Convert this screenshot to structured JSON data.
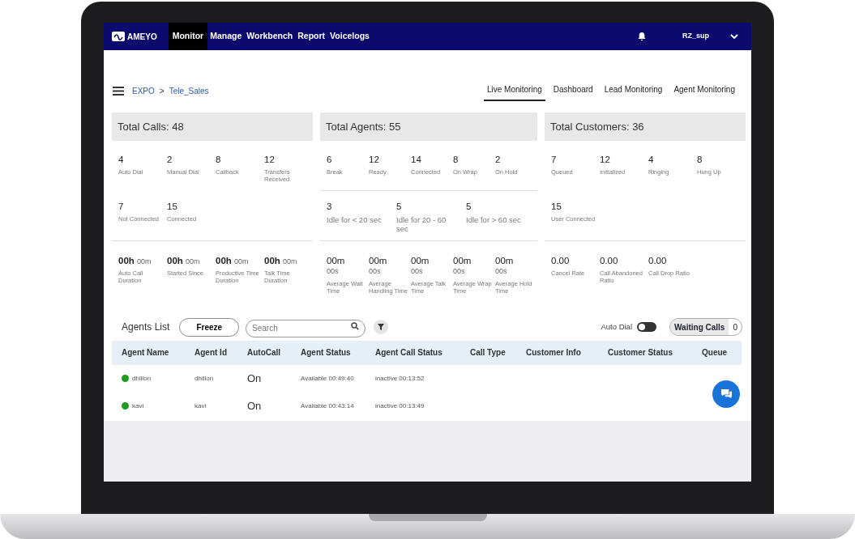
{
  "navbar": {
    "logo": "AMEYO",
    "menu": [
      {
        "label": "Monitor",
        "selected": true
      },
      {
        "label": "Manage",
        "selected": false
      },
      {
        "label": "Workbench",
        "selected": false
      },
      {
        "label": "Report",
        "selected": false
      },
      {
        "label": "Voicelogs",
        "selected": false
      }
    ],
    "user": "RZ_sup"
  },
  "breadcrumb": [
    "EXPO",
    "Tele_Sales"
  ],
  "breadcrumb_separator": ">",
  "tabs": [
    {
      "label": "Live Monitoring",
      "selected": true
    },
    {
      "label": "Dashboard",
      "selected": false
    },
    {
      "label": "Lead Monitoring",
      "selected": false
    },
    {
      "label": "Agent Monitoring",
      "selected": false
    }
  ],
  "panels": [
    {
      "title": "Total Calls: 48",
      "groups": [
        {
          "items": [
            {
              "kind": "count",
              "value": "4",
              "label": "Auto Dial"
            },
            {
              "kind": "count",
              "value": "2",
              "label": "Manual Dial"
            },
            {
              "kind": "count",
              "value": "8",
              "label": "Callback"
            },
            {
              "kind": "count",
              "value": "12",
              "label": "Transfers Received"
            }
          ]
        },
        {
          "items": [
            {
              "kind": "count",
              "value": "7",
              "label": "Not Connected"
            },
            {
              "kind": "count",
              "value": "15",
              "label": "Connected"
            }
          ]
        },
        {
          "items": [
            {
              "kind": "inline",
              "value": "00h",
              "sub": "00m",
              "label": "Auto Call Duration"
            },
            {
              "kind": "inline",
              "value": "00h",
              "sub": "00m",
              "label": "Started Since"
            },
            {
              "kind": "inline",
              "value": "00h",
              "sub": "00m",
              "label": "Productive Time Duration"
            },
            {
              "kind": "inline",
              "value": "00h",
              "sub": "00m",
              "label": "Talk Time Duration"
            }
          ]
        }
      ]
    },
    {
      "title": "Total Agents: 55",
      "groups": [
        {
          "items": [
            {
              "kind": "count",
              "value": "6",
              "label": "Break"
            },
            {
              "kind": "count",
              "value": "12",
              "label": "Ready"
            },
            {
              "kind": "count",
              "value": "14",
              "label": "Connected"
            },
            {
              "kind": "count",
              "value": "8",
              "label": "On Wrap"
            },
            {
              "kind": "count",
              "value": "2",
              "label": "On Hold"
            }
          ]
        },
        {
          "items": [
            {
              "kind": "idle",
              "value": "3",
              "label": "Idle for < 20 sec"
            },
            {
              "kind": "idle",
              "value": "5",
              "label": "Idle for 20 - 60 sec"
            },
            {
              "kind": "idle",
              "value": "5",
              "label": "Idle for > 60 sec"
            }
          ]
        },
        {
          "items": [
            {
              "kind": "stacked",
              "value": "00m",
              "sub": "00s",
              "label": "Average Wait Time"
            },
            {
              "kind": "stacked",
              "value": "00m",
              "sub": "00s",
              "label": "Average Handling Time"
            },
            {
              "kind": "stacked",
              "value": "00m",
              "sub": "00s",
              "label": "Average Talk Time"
            },
            {
              "kind": "stacked",
              "value": "00m",
              "sub": "00s",
              "label": "Average Wrap Time"
            },
            {
              "kind": "stacked",
              "value": "00m",
              "sub": "00s",
              "label": "Average Hold Time"
            }
          ]
        }
      ]
    },
    {
      "title": "Total Customers: 36",
      "groups": [
        {
          "items": [
            {
              "kind": "count",
              "value": "7",
              "label": "Queued"
            },
            {
              "kind": "count",
              "value": "12",
              "label": "Initialized"
            },
            {
              "kind": "count",
              "value": "4",
              "label": "Ringing"
            },
            {
              "kind": "count",
              "value": "8",
              "label": "Hung Up"
            }
          ]
        },
        {
          "items": [
            {
              "kind": "count",
              "value": "15",
              "label": "User Connected"
            }
          ]
        },
        {
          "items": [
            {
              "kind": "rate",
              "value": "0.00",
              "label": "Cancel Rate"
            },
            {
              "kind": "rate",
              "value": "0.00",
              "label": "Call Abandoned Ratio"
            },
            {
              "kind": "rate",
              "value": "0.00",
              "label": "Call Drop Ratio"
            }
          ]
        }
      ]
    }
  ],
  "agents_list": {
    "title": "Agents List",
    "freeze_button": "Freeze",
    "search": {
      "placeholder": "Search"
    },
    "auto_dial": {
      "label": "Auto Dial",
      "on": false
    },
    "waiting_calls": {
      "label": "Waiting Calls",
      "count": "0"
    }
  },
  "table": {
    "columns": [
      "Agent Name",
      "Agent Id",
      "AutoCall",
      "Agent Status",
      "Agent Call Status",
      "Call Type",
      "Customer Info",
      "Customer Status",
      "Queue"
    ],
    "rows": [
      {
        "color": "#1e9a1e",
        "name": "dhillon",
        "id": "dhillon",
        "autocall": "On",
        "status": "Available 00:49:40",
        "call_status": "inactive 00:13:52"
      },
      {
        "color": "#1e9a1e",
        "name": "kavi",
        "id": "kavi",
        "autocall": "On",
        "status": "Available 00:43:14",
        "call_status": "inactive 00:13:49"
      }
    ]
  }
}
